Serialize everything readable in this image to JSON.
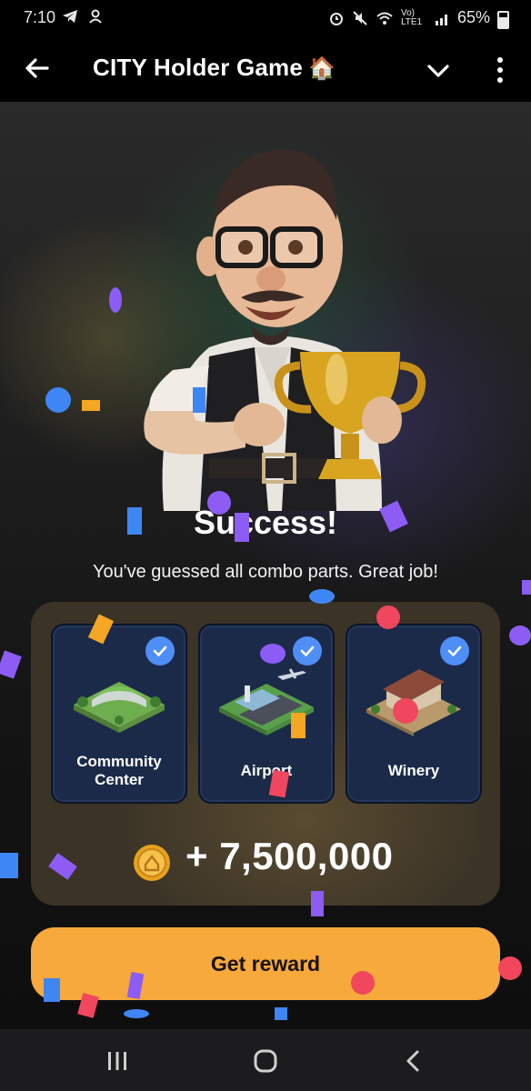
{
  "status_bar": {
    "time": "7:10",
    "network_label": "Vo) LTE1",
    "battery_percent": "65%"
  },
  "app_bar": {
    "title": "CITY Holder Game",
    "title_emoji": "🏠"
  },
  "result": {
    "headline": "Success!",
    "message": "You've guessed all combo parts. Great job!"
  },
  "combo_cards": [
    {
      "label_line1": "Community",
      "label_line2": "Center",
      "checked": true
    },
    {
      "label_line1": "Airport",
      "label_line2": "",
      "checked": true
    },
    {
      "label_line1": "Winery",
      "label_line2": "",
      "checked": true
    }
  ],
  "reward": {
    "amount": "+ 7,500,000"
  },
  "cta": {
    "label": "Get reward"
  },
  "colors": {
    "accent": "#f7a93b",
    "check_badge": "#4f8ef7",
    "card_bg": "#1b2a48",
    "panel_bg": "#3a3326"
  },
  "icons": [
    "back-arrow-icon",
    "chevron-down-icon",
    "more-vertical-icon",
    "check-icon",
    "coin-icon",
    "recent-apps-icon",
    "home-icon",
    "back-nav-icon"
  ]
}
